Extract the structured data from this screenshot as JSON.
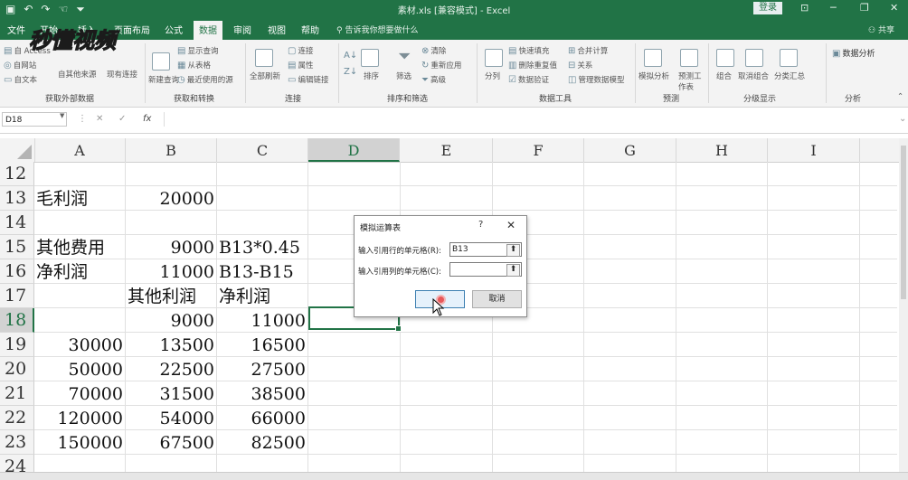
{
  "titlebar": {
    "title": "素材.xls [兼容模式] - Excel",
    "login_label": "登录",
    "qat_icons": [
      "save-icon",
      "undo-icon",
      "redo-icon",
      "touch-mode-icon",
      "customize-qat-icon"
    ]
  },
  "tabs": [
    {
      "label": "文件"
    },
    {
      "label": "开始"
    },
    {
      "label": "插入"
    },
    {
      "label": "页面布局"
    },
    {
      "label": "公式"
    },
    {
      "label": "数据"
    },
    {
      "label": "审阅"
    },
    {
      "label": "视图"
    },
    {
      "label": "帮助"
    }
  ],
  "active_tab": "数据",
  "tell_me": "告诉我你想要做什么",
  "share_label": "共享",
  "watermark": "秒懂视频",
  "ribbon": {
    "groups": [
      {
        "label": "获取外部数据",
        "items": [
          "自 Access",
          "自网站",
          "自文本",
          "自其他来源",
          "现有连接"
        ]
      },
      {
        "label": "获取和转换",
        "items": [
          "显示查询",
          "从表格",
          "最近使用的源",
          "新建查询"
        ]
      },
      {
        "label": "连接",
        "items": [
          "连接",
          "属性",
          "编辑链接",
          "全部刷新"
        ]
      },
      {
        "label": "排序和筛选",
        "items": [
          "排序",
          "筛选",
          "清除",
          "重新应用",
          "高级"
        ]
      },
      {
        "label": "数据工具",
        "items": [
          "分列",
          "快速填充",
          "删除重复值",
          "数据验证",
          "合并计算",
          "关系",
          "管理数据模型"
        ]
      },
      {
        "label": "预测",
        "items": [
          "模拟分析",
          "预测工作表"
        ]
      },
      {
        "label": "分级显示",
        "items": [
          "组合",
          "取消组合",
          "分类汇总"
        ]
      },
      {
        "label": "分析",
        "items": [
          "数据分析"
        ]
      }
    ]
  },
  "formula_bar": {
    "name_box": "D18",
    "formula": ""
  },
  "columns": [
    "A",
    "B",
    "C",
    "D",
    "E",
    "F",
    "G",
    "H",
    "I"
  ],
  "selected_column": "D",
  "selected_row": "18",
  "rows": [
    {
      "n": "12",
      "cells": [
        "",
        "",
        ""
      ]
    },
    {
      "n": "13",
      "cells": [
        "毛利润",
        "20000",
        ""
      ]
    },
    {
      "n": "14",
      "cells": [
        "",
        "",
        ""
      ]
    },
    {
      "n": "15",
      "cells": [
        "其他费用",
        "9000",
        "B13*0.45"
      ]
    },
    {
      "n": "16",
      "cells": [
        "净利润",
        "11000",
        "B13-B15"
      ]
    },
    {
      "n": "17",
      "cells": [
        "",
        "其他利润",
        "净利润"
      ]
    },
    {
      "n": "18",
      "cells": [
        "",
        "9000",
        "11000"
      ]
    },
    {
      "n": "19",
      "cells": [
        "30000",
        "13500",
        "16500"
      ]
    },
    {
      "n": "20",
      "cells": [
        "50000",
        "22500",
        "27500"
      ]
    },
    {
      "n": "21",
      "cells": [
        "70000",
        "31500",
        "38500"
      ]
    },
    {
      "n": "22",
      "cells": [
        "120000",
        "54000",
        "66000"
      ]
    },
    {
      "n": "23",
      "cells": [
        "150000",
        "67500",
        "82500"
      ]
    },
    {
      "n": "24",
      "cells": [
        "",
        "",
        ""
      ]
    }
  ],
  "dialog": {
    "title": "模拟运算表",
    "help": "?",
    "close": "✕",
    "row_input_label": "输入引用行的单元格(R):",
    "row_input_value": "B13",
    "col_input_label": "输入引用列的单元格(C):",
    "col_input_value": "",
    "ok_label": "确定",
    "cancel_label": "取消"
  }
}
